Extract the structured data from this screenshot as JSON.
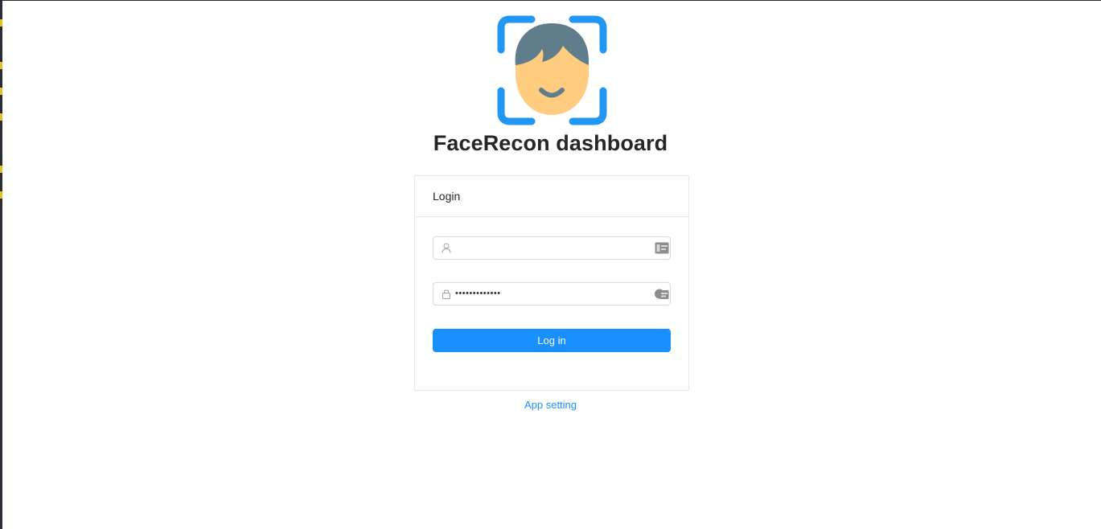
{
  "app": {
    "title": "FaceRecon dashboard",
    "logo_icon": "face-recognition-icon"
  },
  "login_card": {
    "header": "Login",
    "username": {
      "value": "",
      "placeholder": "",
      "prefix_icon": "user-icon",
      "suffix_icon": "autofill-card-icon"
    },
    "password": {
      "masked_value": "•••••••••••••",
      "prefix_icon": "lock-icon",
      "suffix_icon": "autofill-key-icon"
    },
    "submit_label": "Log in"
  },
  "footer_link": "App setting",
  "colors": {
    "primary": "#1890ff",
    "logo_frame": "#2196f3",
    "hair": "#607d8b",
    "skin": "#ffcc80",
    "left_strip": "#2a2d33",
    "left_strip_marks": "#e2c21c"
  }
}
